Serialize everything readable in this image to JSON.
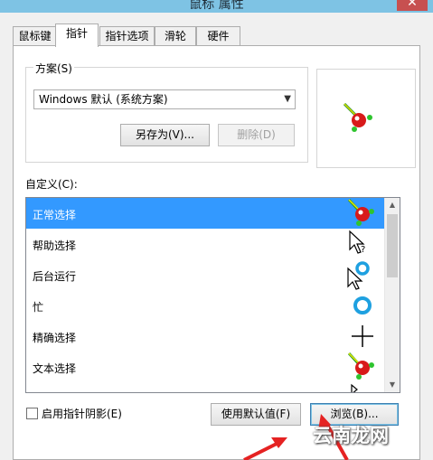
{
  "window": {
    "title": "鼠标 属性",
    "close_glyph": "✕"
  },
  "tabs": [
    {
      "label": "鼠标键",
      "active": false
    },
    {
      "label": "指针",
      "active": true
    },
    {
      "label": "指针选项",
      "active": false
    },
    {
      "label": "滑轮",
      "active": false
    },
    {
      "label": "硬件",
      "active": false
    }
  ],
  "scheme": {
    "group_label": "方案(S)",
    "selected_value": "Windows 默认 (系统方案)",
    "save_as_label": "另存为(V)...",
    "delete_label": "删除(D)"
  },
  "customize": {
    "label": "自定义(C):",
    "items": [
      {
        "label": "正常选择",
        "cursor_icon": "cursor-with-red-ball-icon",
        "selected": true
      },
      {
        "label": "帮助选择",
        "cursor_icon": "help-cursor-icon",
        "selected": false
      },
      {
        "label": "后台运行",
        "cursor_icon": "working-in-background-cursor-icon",
        "selected": false
      },
      {
        "label": "忙",
        "cursor_icon": "busy-ring-icon",
        "selected": false
      },
      {
        "label": "精确选择",
        "cursor_icon": "crosshair-icon",
        "selected": false
      },
      {
        "label": "文本选择",
        "cursor_icon": "cursor-with-red-ball-icon",
        "selected": false
      }
    ]
  },
  "footer": {
    "shadow_checkbox_label": "启用指针阴影(E)",
    "shadow_checked": false,
    "use_default_label": "使用默认值(F)",
    "browse_label": "浏览(B)..."
  },
  "watermark": "云南龙网",
  "colors": {
    "selection": "#3399ff",
    "titlebar": "#7ec3e4",
    "close": "#c75050",
    "annotation_arrow": "#e52222"
  }
}
